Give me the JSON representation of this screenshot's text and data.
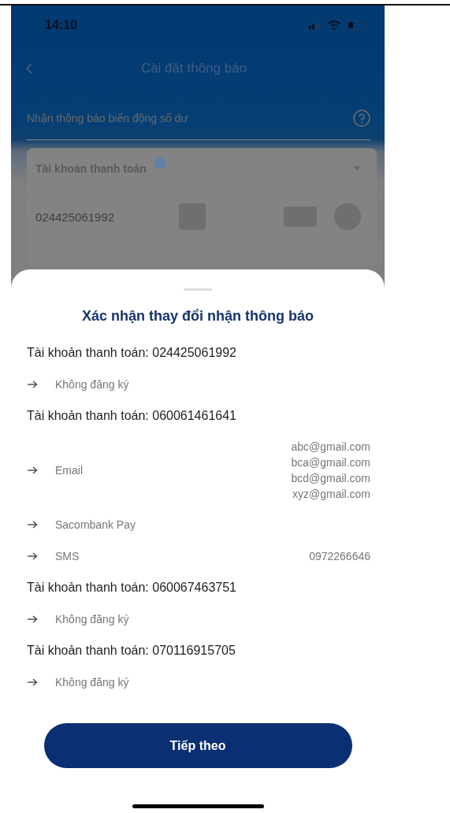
{
  "status_bar": {
    "time": "14:10"
  },
  "header": {
    "title": "Cài đặt thông báo"
  },
  "balance_alert": {
    "label": "Nhận thông báo biến động số dư"
  },
  "account_card": {
    "type_label": "Tài khoản thanh toán",
    "account_number": "024425061992"
  },
  "sheet": {
    "title": "Xác nhận thay đổi nhận thông báo",
    "accounts": [
      {
        "label": "Tài khoản thanh toán: 024425061992",
        "channels": [
          {
            "name": "Không đăng ký"
          }
        ]
      },
      {
        "label": "Tài khoản thanh toán: 060061461641",
        "channels": [
          {
            "name": "Email",
            "values": [
              "abc@gmail.com",
              "bca@gmail.com",
              "bcd@gmail.com",
              "xyz@gmail.com"
            ]
          },
          {
            "name": "Sacombank Pay"
          },
          {
            "name": "SMS",
            "values": [
              "0972266646"
            ]
          }
        ]
      },
      {
        "label": "Tài khoản thanh toán: 060067463751",
        "channels": [
          {
            "name": "Không đăng ký"
          }
        ]
      },
      {
        "label": "Tài khoản thanh toán: 070116915705",
        "channels": [
          {
            "name": "Không đăng ký"
          }
        ]
      }
    ],
    "button": {
      "label": "Tiếp theo"
    }
  }
}
